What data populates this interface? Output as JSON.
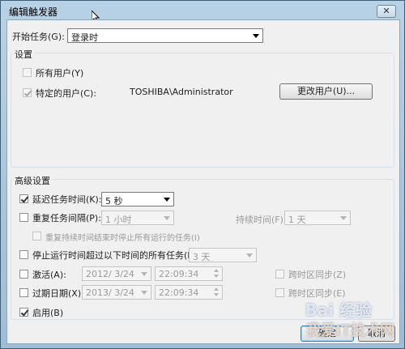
{
  "window": {
    "title": "编辑触发器",
    "close_glyph": "✕"
  },
  "begin_task": {
    "label": "开始任务(G):",
    "value": "登录时"
  },
  "settings": {
    "title": "设置",
    "all_users": {
      "label": "所有用户(Y)",
      "checked": false
    },
    "specific_user": {
      "label": "特定的用户(C):",
      "value": "TOSHIBA\\Administrator",
      "checked": true
    },
    "change_user_button": "更改用户(U)..."
  },
  "advanced": {
    "title": "高级设置",
    "delay": {
      "label": "延迟任务时间(K):",
      "value": "5 秒",
      "checked": true
    },
    "repeat": {
      "label": "重复任务间隔(P):",
      "value": "1 小时",
      "checked": false
    },
    "duration": {
      "label": "持续时间(F):",
      "value": "1 天"
    },
    "stop_repeat": {
      "label": "重复持续时间结束时停止所有运行的任务(I)",
      "checked": false
    },
    "stop_long": {
      "label": "停止运行时间超过以下时间的所有任务(L):",
      "value": "3 天",
      "checked": false
    },
    "activate": {
      "label": "激活(A):",
      "date": "2012/  3/24",
      "time": "22:09:34",
      "sync_label": "跨时区同步(Z)",
      "checked": false
    },
    "expire": {
      "label": "过期日期(X):",
      "date": "2013/  3/24",
      "time": "22:09:34",
      "sync_label": "跨时区同步(E)",
      "checked": false
    },
    "enabled": {
      "label": "启用(B)",
      "checked": true
    }
  },
  "footer": {
    "ok": "确定",
    "cancel": "取消"
  },
  "watermark": {
    "top": "Bai 经验",
    "bottom": "我爱IT技术网"
  }
}
